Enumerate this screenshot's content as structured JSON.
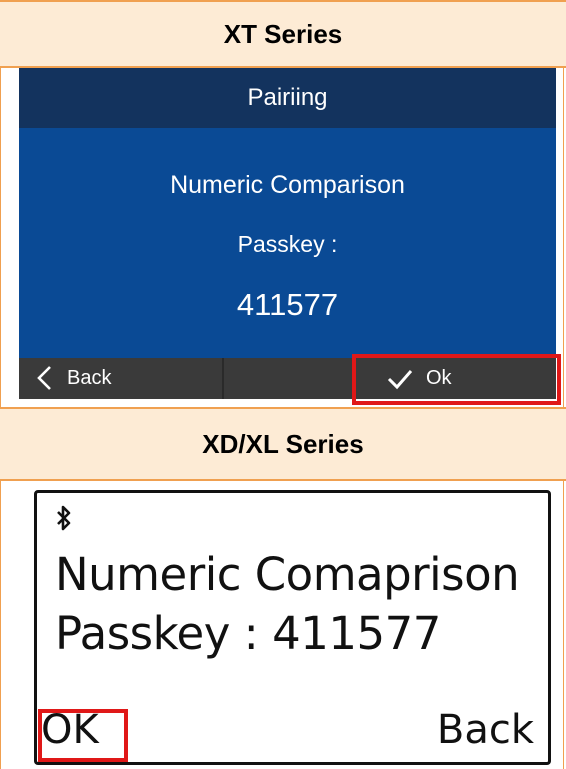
{
  "sections": [
    {
      "title": "XT Series"
    },
    {
      "title": "XD/XL Series"
    }
  ],
  "xt": {
    "title": "Pairiing",
    "method": "Numeric Comparison",
    "passkey_label": "Passkey :",
    "passkey": "411577",
    "back_label": "Back",
    "ok_label": "Ok",
    "highlight_color": "#e01818",
    "screen_color": "#0a4a95",
    "title_color": "#13335e"
  },
  "xdxl": {
    "icon": "bluetooth-icon",
    "method": "Numeric Comaprison",
    "passkey_line": "Passkey : 411577",
    "ok_label": "OK",
    "back_label": "Back"
  },
  "colors": {
    "header_bg": "#fdebd5",
    "header_border": "#f0a050"
  }
}
